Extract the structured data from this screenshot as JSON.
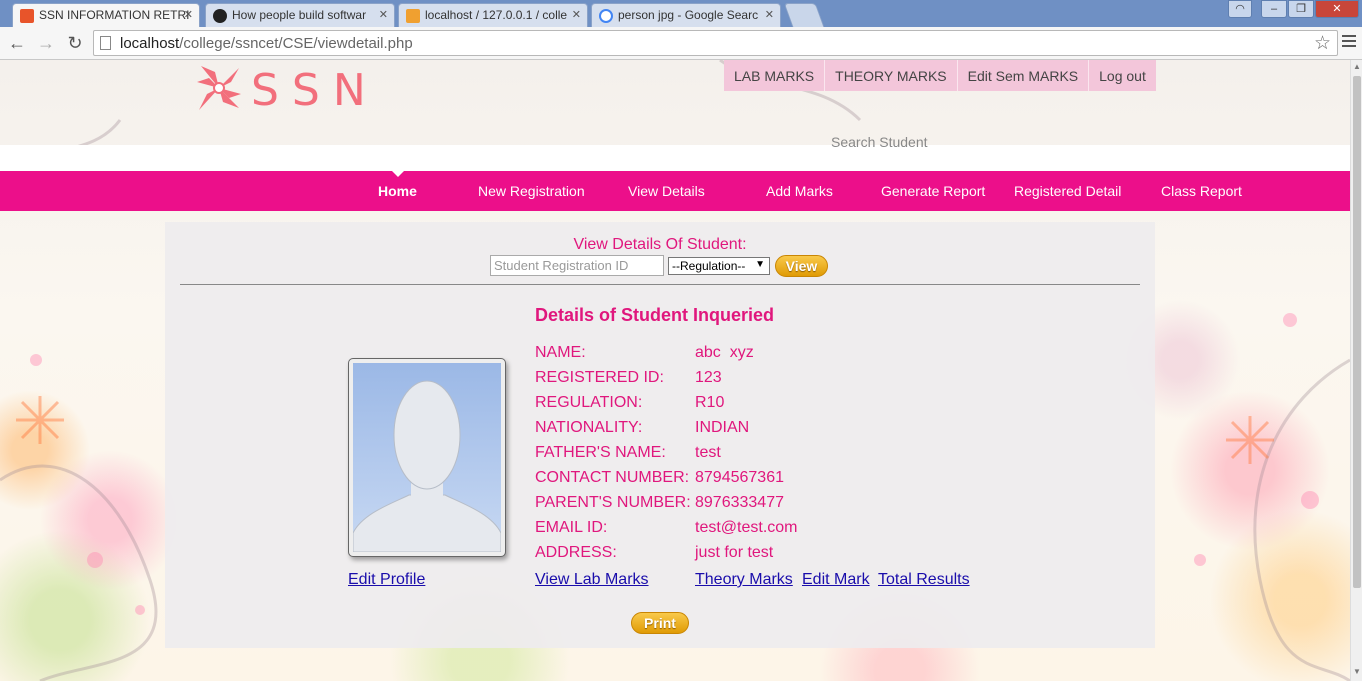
{
  "browser": {
    "tabs": [
      {
        "title": "SSN INFORMATION RETRI",
        "favicon": "ssn-favicon",
        "active": true
      },
      {
        "title": "How people build softwar",
        "favicon": "github-icon",
        "active": false
      },
      {
        "title": "localhost / 127.0.0.1 / colle",
        "favicon": "phpmyadmin-icon",
        "active": false
      },
      {
        "title": "person jpg - Google Searc",
        "favicon": "google-icon",
        "active": false
      }
    ],
    "url_host": "localhost",
    "url_path": "/college/ssncet/CSE/viewdetail.php"
  },
  "header": {
    "logo_text": "SSN",
    "top_menu": [
      "LAB MARKS",
      "THEORY MARKS",
      "Edit Sem MARKS",
      "Log out"
    ],
    "search_label": "Search Student"
  },
  "nav": {
    "items": [
      "Home",
      "New Registration",
      "View Details",
      "Add Marks",
      "Generate Report",
      "Registered Detail",
      "Class Report"
    ],
    "active": "Home"
  },
  "search_form": {
    "heading": "View Details Of Student:",
    "id_placeholder": "Student Registration ID",
    "regulation_selected": "--Regulation--",
    "view_label": "View"
  },
  "student": {
    "title": "Details of Student Inqueried",
    "fields": [
      {
        "label": "NAME:",
        "value": "abc  xyz"
      },
      {
        "label": "REGISTERED ID:",
        "value": "123"
      },
      {
        "label": "REGULATION:",
        "value": "R10"
      },
      {
        "label": "NATIONALITY:",
        "value": "INDIAN"
      },
      {
        "label": "FATHER'S NAME:",
        "value": "test"
      },
      {
        "label": "CONTACT NUMBER:",
        "value": "8794567361"
      },
      {
        "label": "PARENT'S NUMBER:",
        "value": "8976333477"
      },
      {
        "label": "EMAIL ID:",
        "value": "test@test.com"
      },
      {
        "label": "ADDRESS:",
        "value": "just for test"
      }
    ]
  },
  "links": {
    "edit_profile": "Edit Profile",
    "view_lab_marks": "View Lab Marks",
    "theory_marks": "Theory Marks",
    "edit_mark": "Edit Mark",
    "total_results": "Total Results"
  },
  "print_label": "Print",
  "colors": {
    "accent": "#ec0f8a",
    "text_pink": "#e0177d",
    "button_gold": "#e9a81a",
    "link": "#1a0dab"
  }
}
